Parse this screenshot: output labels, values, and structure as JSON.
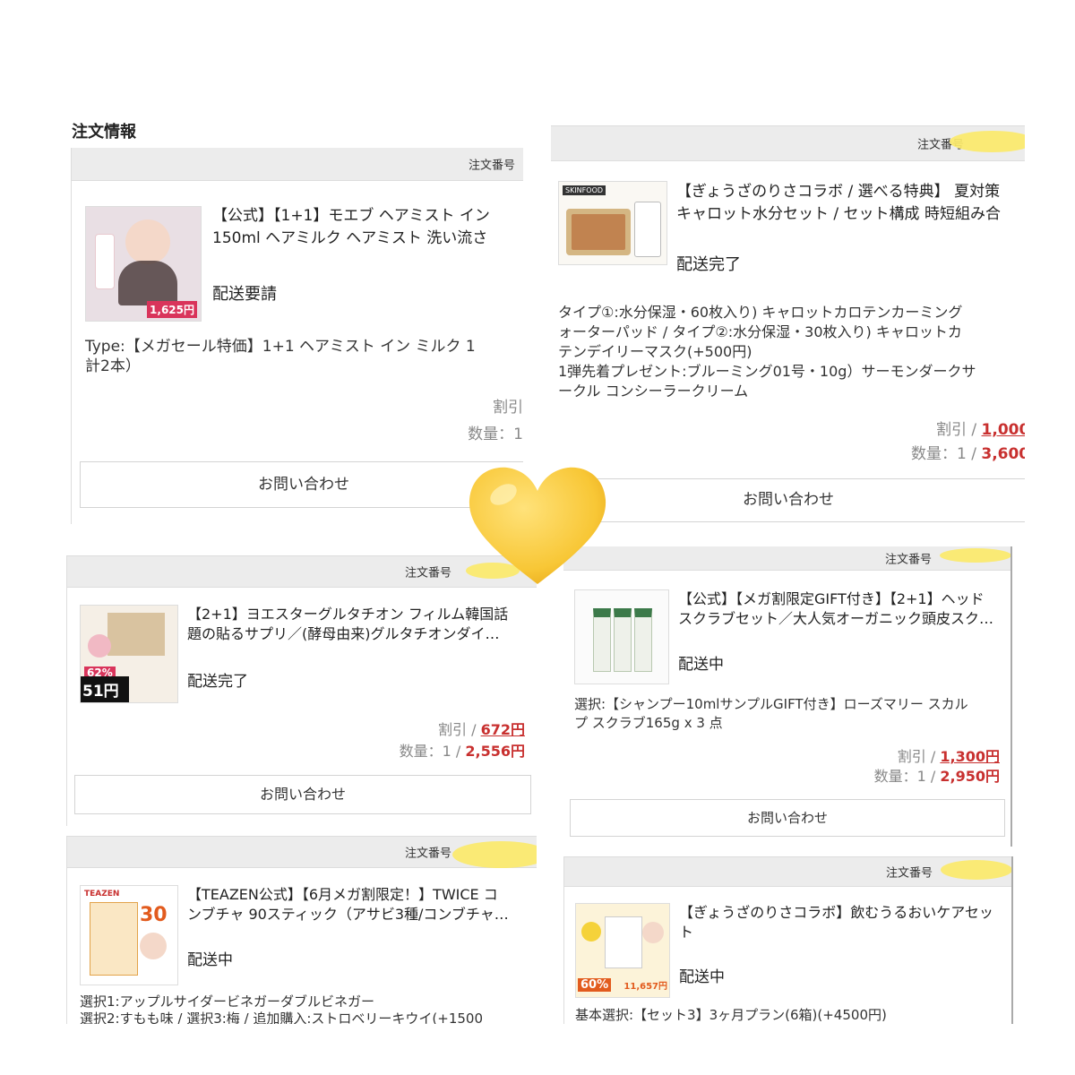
{
  "orders": {
    "heading": "注文情報",
    "order_no_label": "注文番号",
    "card1": {
      "title": "【公式】【1+1】モエブ ヘアミスト イン\n150ml ヘアミルク ヘアミスト 洗い流さ",
      "status": "配送要請",
      "options": "Type:【メガセール特価】1+1 ヘアミスト イン ミルク 1\n計2本）",
      "discount_label": "割引",
      "qty_label": "数量：1",
      "contact": "お問い合わせ",
      "thumb_badge": "1,625円"
    },
    "card2": {
      "title": "【ぎょうざのりさコラボ / 選べる特典】 夏対策\nキャロット水分セット / セット構成 時短組み合",
      "status": "配送完了",
      "options": "タイプ①:水分保湿・60枚入り) キャロットカロテンカーミング\nォーターパッド / タイプ②:水分保湿・30枚入り) キャロットカ\nテンデイリーマスク(+500円)\n1弾先着プレゼント:ブルーミング01号・10g）サーモンダークサ\nークル コンシーラークリーム",
      "discount_label": "割引 / ",
      "discount_value": "1,000",
      "qty_label": "数量：1 / ",
      "qty_value": "3,600",
      "contact": "お問い合わせ",
      "thumb_brand": "SKINFOOD"
    },
    "card3": {
      "title": "【2+1】ヨエスターグルタチオン フィルム韓国話\n題の貼るサプリ／(酵母由来)グルタチオンダイ…",
      "status": "配送完了",
      "discount_label": "割引 / ",
      "discount_value": "672円",
      "qty_label": "数量：1 / ",
      "qty_value": "2,556円",
      "contact": "お問い合わせ",
      "thumb_pct": "62%",
      "thumb_price": "51円"
    },
    "card4": {
      "title": "【公式】【メガ割限定GIFT付き】【2+1】ヘッド\nスクラブセット／大人気オーガニック頭皮スク…",
      "status": "配送中",
      "options": "選択:【シャンプー10mlサンプルGIFT付き】ローズマリー スカル\nプ スクラブ165g x 3 点",
      "discount_label": "割引 / ",
      "discount_value": "1,300円",
      "qty_label": "数量：1 / ",
      "qty_value": "2,950円",
      "contact": "お問い合わせ"
    },
    "card5": {
      "title": "【TEAZEN公式】【6月メガ割限定！】TWICE コ\nンブチャ 90スティック（アサビ3種/コンブチャ…",
      "status": "配送中",
      "options": "選択1:アップルサイダービネガーダブルビネガー\n選択2:すもも味 / 選択3:梅 / 追加購入:ストロベリーキウイ(+1500",
      "thumb_brand": "TEAZEN",
      "thumb_num": "30"
    },
    "card6": {
      "title": "【ぎょうざのりさコラボ】飲むうるおいケアセッ\nト",
      "status": "配送中",
      "options": "基本選択:【セット3】3ヶ月プラン(6箱)(+4500円)",
      "thumb_pct": "60%",
      "thumb_price": "11,657円"
    }
  },
  "decor": {
    "heart_icon": "yellow-heart",
    "accent": "#c8302f",
    "header_bg": "#ececec",
    "scribble_color": "#fbe96a"
  }
}
